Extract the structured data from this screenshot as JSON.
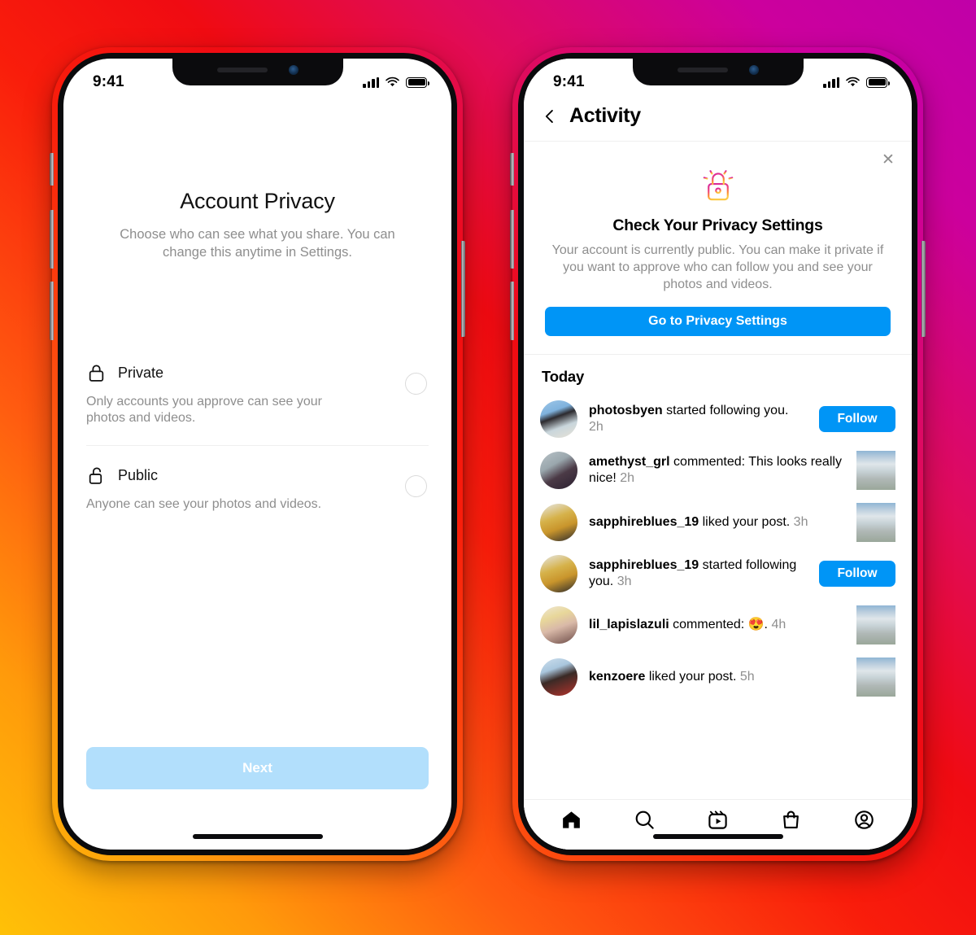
{
  "background": {
    "gradient_colors": [
      "#ffc107",
      "#ff5c10",
      "#f00b12",
      "#cc009d"
    ]
  },
  "colors": {
    "accent_blue": "#0095f6",
    "disabled_blue": "#b2dffc",
    "secondary_text": "#8e8e8e",
    "divider": "#efefef"
  },
  "left_phone": {
    "status_bar": {
      "time": "9:41",
      "cellular_icon": "signal-bars-icon",
      "wifi_icon": "wifi-icon",
      "battery_icon": "battery-icon"
    },
    "title": "Account Privacy",
    "subtitle": "Choose who can see what you share. You can change this anytime in Settings.",
    "options": [
      {
        "icon": "lock-closed-icon",
        "name": "Private",
        "description": "Only accounts you approve can see your photos and videos.",
        "selected": false
      },
      {
        "icon": "lock-open-icon",
        "name": "Public",
        "description": "Anyone can see your photos and videos.",
        "selected": false
      }
    ],
    "next_button": {
      "label": "Next",
      "disabled": true
    }
  },
  "right_phone": {
    "status_bar": {
      "time": "9:41",
      "cellular_icon": "signal-bars-icon",
      "wifi_icon": "wifi-icon",
      "battery_icon": "battery-icon"
    },
    "header": {
      "back_icon": "chevron-left-icon",
      "title": "Activity"
    },
    "privacy_card": {
      "close_icon": "close-icon",
      "lock_icon": "gradient-lock-icon",
      "title": "Check Your Privacy Settings",
      "body": "Your account is currently public. You can make it private if you want to approve who can follow you and see your photos and videos.",
      "cta_label": "Go to Privacy Settings"
    },
    "feed": {
      "section_title": "Today",
      "items": [
        {
          "avatar": "avatar-photosbyen",
          "username": "photosbyen",
          "action": "started following you.",
          "time": "2h",
          "trailing": "follow-button",
          "follow_label": "Follow"
        },
        {
          "avatar": "avatar-amethyst-grl",
          "username": "amethyst_grl",
          "action": "commented: This looks really nice!",
          "time": "2h",
          "trailing": "post-thumbnail"
        },
        {
          "avatar": "avatar-sapphireblues-19",
          "username": "sapphireblues_19",
          "action": "liked your post.",
          "time": "3h",
          "trailing": "post-thumbnail"
        },
        {
          "avatar": "avatar-sapphireblues-19",
          "username": "sapphireblues_19",
          "action": "started following you.",
          "time": "3h",
          "trailing": "follow-button",
          "follow_label": "Follow"
        },
        {
          "avatar": "avatar-lil-lapislazuli",
          "username": "lil_lapislazuli",
          "action": "commented: 😍.",
          "time": "4h",
          "trailing": "post-thumbnail"
        },
        {
          "avatar": "avatar-kenzoere",
          "username": "kenzoere",
          "action": "liked your post.",
          "time": "5h",
          "trailing": "post-thumbnail"
        }
      ]
    },
    "tabbar": {
      "items": [
        {
          "icon": "home-icon",
          "active": true
        },
        {
          "icon": "search-icon",
          "active": false
        },
        {
          "icon": "reels-icon",
          "active": false
        },
        {
          "icon": "shop-icon",
          "active": false
        },
        {
          "icon": "profile-icon",
          "active": false
        }
      ]
    }
  }
}
